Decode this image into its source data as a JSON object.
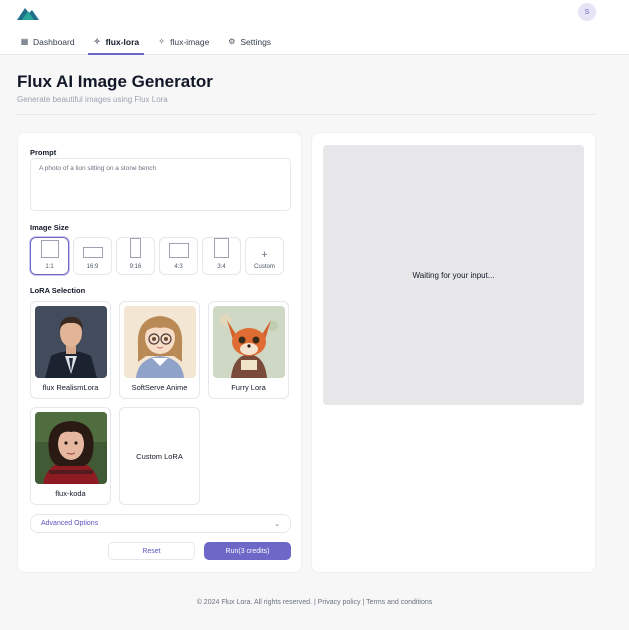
{
  "header": {
    "avatar_initial": "S",
    "nav": [
      {
        "label": "Dashboard",
        "icon": "grid-icon",
        "glyph": "▦",
        "active": false
      },
      {
        "label": "flux-lora",
        "icon": "wand-icon",
        "glyph": "✧",
        "active": true
      },
      {
        "label": "flux-image",
        "icon": "wand-icon",
        "glyph": "✧",
        "active": false
      },
      {
        "label": "Settings",
        "icon": "gear-icon",
        "glyph": "⚙",
        "active": false
      }
    ]
  },
  "page": {
    "title": "Flux AI Image Generator",
    "subtitle": "Generate beautiful images using Flux Lora"
  },
  "form": {
    "prompt_label": "Prompt",
    "prompt_placeholder": "A photo of a lion sitting on a stone bench",
    "size_label": "Image Size",
    "sizes": [
      {
        "label": "1:1",
        "selected": true
      },
      {
        "label": "16:9",
        "selected": false
      },
      {
        "label": "9:16",
        "selected": false
      },
      {
        "label": "4:3",
        "selected": false
      },
      {
        "label": "3:4",
        "selected": false
      },
      {
        "label": "Custom",
        "selected": false
      }
    ],
    "lora_label": "LoRA Selection",
    "loras": [
      {
        "name": "flux RealismLora"
      },
      {
        "name": "SoftServe Anime"
      },
      {
        "name": "Furry Lora"
      },
      {
        "name": "flux-koda"
      },
      {
        "name": "Custom LoRA"
      }
    ],
    "advanced_label": "Advanced Options",
    "reset_label": "Reset",
    "run_label": "Run(3 credits)"
  },
  "output": {
    "waiting_text": "Waiting for your input..."
  },
  "footer": {
    "copyright": "© 2024 Flux Lora. All rights reserved.",
    "sep": "|",
    "privacy": "Privacy policy",
    "terms": "Terms and conditions"
  },
  "colors": {
    "accent": "#6d67c7",
    "background": "#f7f7f8"
  }
}
